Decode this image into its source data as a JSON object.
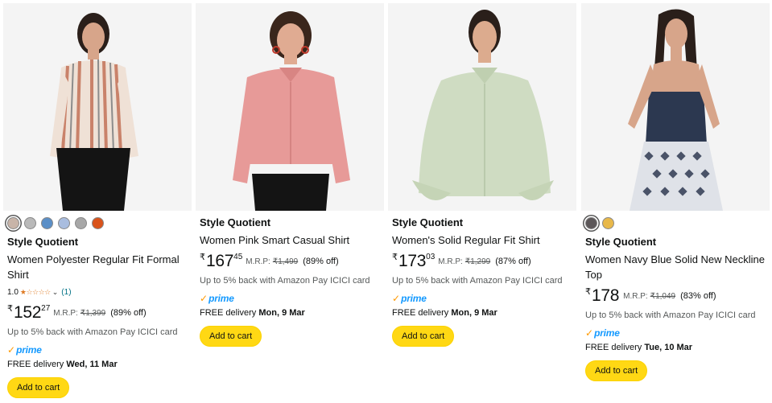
{
  "products": [
    {
      "brand": "Style Quotient",
      "title_line1": "Women Polyester Regular Fit Formal",
      "title_line2": "Shirt",
      "swatches": [
        "#c8b4a8",
        "#b9b9b9",
        "#5b8fc7",
        "#a9bddf",
        "#a7a7a7",
        "#d9531b"
      ],
      "rating": "1.0",
      "stars": "★☆☆☆☆",
      "rating_count": "(1)",
      "currency": "₹",
      "price_whole": "152",
      "price_fraction": "27",
      "mrp_label": "M.R.P:",
      "mrp_value": "₹1,399",
      "discount": "(89% off)",
      "cashback": "Up to 5% back with Amazon Pay ICICI card",
      "prime": "prime",
      "delivery_label": "FREE delivery",
      "delivery_date": "Wed, 11 Mar",
      "cart_label": "Add to cart"
    },
    {
      "brand": "Style Quotient",
      "title_line1": "Women Pink Smart Casual Shirt",
      "currency": "₹",
      "price_whole": "167",
      "price_fraction": "45",
      "mrp_label": "M.R.P:",
      "mrp_value": "₹1,499",
      "discount": "(89% off)",
      "cashback": "Up to 5% back with Amazon Pay ICICI card",
      "prime": "prime",
      "delivery_label": "FREE delivery",
      "delivery_date": "Mon, 9 Mar",
      "cart_label": "Add to cart"
    },
    {
      "brand": "Style Quotient",
      "title_line1": "Women's Solid Regular Fit Shirt",
      "currency": "₹",
      "price_whole": "173",
      "price_fraction": "03",
      "mrp_label": "M.R.P:",
      "mrp_value": "₹1,299",
      "discount": "(87% off)",
      "cashback": "Up to 5% back with Amazon Pay ICICI card",
      "prime": "prime",
      "delivery_label": "FREE delivery",
      "delivery_date": "Mon, 9 Mar",
      "cart_label": "Add to cart"
    },
    {
      "brand": "Style Quotient",
      "title_line1": "Women Navy Blue Solid New Neckline",
      "title_line2": "Top",
      "swatches": [
        "#5c5759",
        "#e8b84a"
      ],
      "currency": "₹",
      "price_whole": "178",
      "price_fraction": "",
      "mrp_label": "M.R.P:",
      "mrp_value": "₹1,049",
      "discount": "(83% off)",
      "cashback": "Up to 5% back with Amazon Pay ICICI card",
      "prime": "prime",
      "delivery_label": "FREE delivery",
      "delivery_date": "Tue, 10 Mar",
      "cart_label": "Add to cart"
    }
  ],
  "colors": {
    "cart_button": "#ffd814",
    "prime_blue": "#1399ff",
    "prime_check": "#ff9900",
    "star": "#de7921",
    "link": "#007185"
  }
}
